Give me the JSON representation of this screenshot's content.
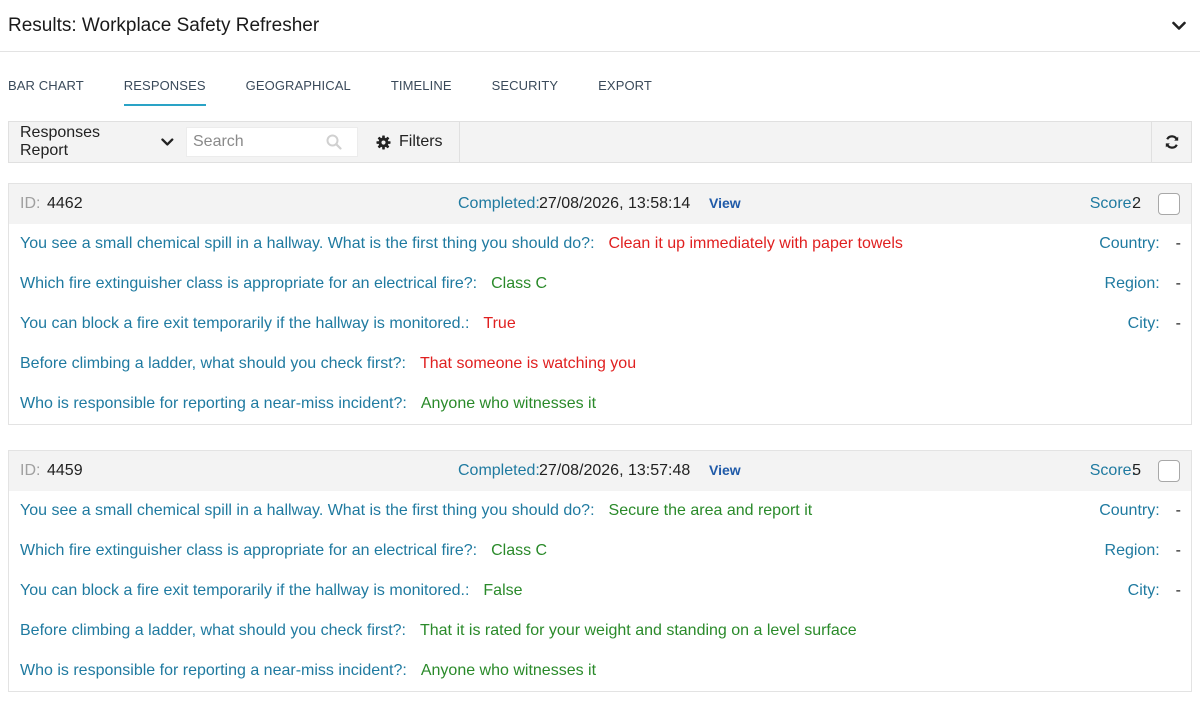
{
  "header": {
    "title": "Results: Workplace Safety Refresher"
  },
  "tabs": [
    {
      "label": "BAR CHART",
      "active": false
    },
    {
      "label": "RESPONSES",
      "active": true
    },
    {
      "label": "GEOGRAPHICAL",
      "active": false
    },
    {
      "label": "TIMELINE",
      "active": false
    },
    {
      "label": "SECURITY",
      "active": false
    },
    {
      "label": "EXPORT",
      "active": false
    }
  ],
  "toolbar": {
    "report_select": "Responses Report",
    "search_placeholder": "Search",
    "filters_label": "Filters"
  },
  "colors": {
    "accent": "#2aa3c6",
    "question": "#1f7aa0",
    "correct": "#2a8a2a",
    "wrong": "#e02020"
  },
  "responses": [
    {
      "id_label": "ID:",
      "id": "4462",
      "completed_label": "Completed:",
      "completed": "27/08/2026, 13:58:14",
      "view_label": "View",
      "score_label": "Score:",
      "score": "2",
      "answers": [
        {
          "q": "You see a small chemical spill in a hallway. What is the first thing you should do?:",
          "a": "Clean it up immediately with paper towels",
          "correct": false
        },
        {
          "q": "Which fire extinguisher class is appropriate for an electrical fire?:",
          "a": "Class C",
          "correct": true
        },
        {
          "q": "You can block a fire exit temporarily if the hallway is monitored.:",
          "a": "True",
          "correct": false
        },
        {
          "q": "Before climbing a ladder, what should you check first?:",
          "a": "That someone is watching you",
          "correct": false
        },
        {
          "q": "Who is responsible for reporting a near-miss incident?:",
          "a": "Anyone who witnesses it",
          "correct": true
        }
      ],
      "meta": [
        {
          "label": "Country:",
          "value": "-"
        },
        {
          "label": "Region:",
          "value": "-"
        },
        {
          "label": "City:",
          "value": "-"
        }
      ]
    },
    {
      "id_label": "ID:",
      "id": "4459",
      "completed_label": "Completed:",
      "completed": "27/08/2026, 13:57:48",
      "view_label": "View",
      "score_label": "Score:",
      "score": "5",
      "answers": [
        {
          "q": "You see a small chemical spill in a hallway. What is the first thing you should do?:",
          "a": "Secure the area and report it",
          "correct": true
        },
        {
          "q": "Which fire extinguisher class is appropriate for an electrical fire?:",
          "a": "Class C",
          "correct": true
        },
        {
          "q": "You can block a fire exit temporarily if the hallway is monitored.:",
          "a": "False",
          "correct": true
        },
        {
          "q": "Before climbing a ladder, what should you check first?:",
          "a": "That it is rated for your weight and standing on a level surface",
          "correct": true
        },
        {
          "q": "Who is responsible for reporting a near-miss incident?:",
          "a": "Anyone who witnesses it",
          "correct": true
        }
      ],
      "meta": [
        {
          "label": "Country:",
          "value": "-"
        },
        {
          "label": "Region:",
          "value": "-"
        },
        {
          "label": "City:",
          "value": "-"
        }
      ]
    }
  ]
}
